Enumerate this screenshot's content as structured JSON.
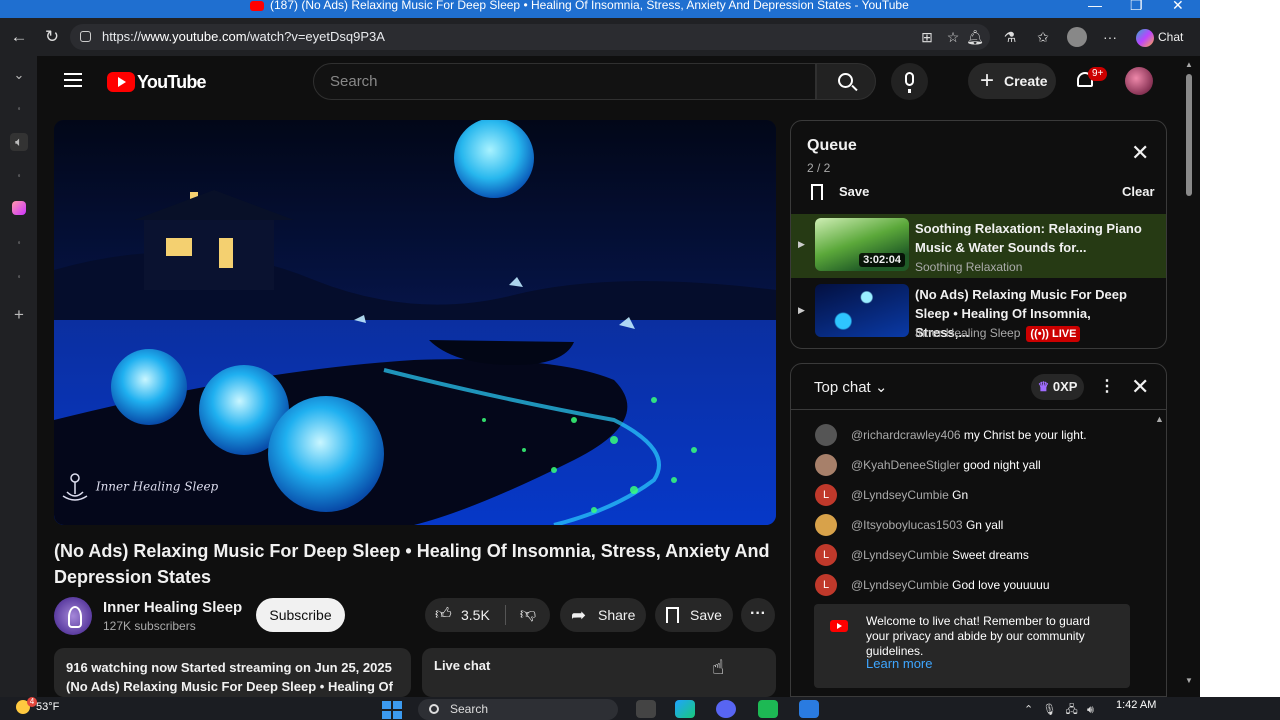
{
  "browser": {
    "tab_title": "(187) (No Ads) Relaxing Music For Deep Sleep • Healing Of Insomnia, Stress, Anxiety And Depression States - YouTube",
    "url_prefix": "https://",
    "url_host": "www.youtube.com",
    "url_path": "/watch?v=eyetDsq9P3A",
    "chat_label": "Chat"
  },
  "header": {
    "logo_text": "YouTube",
    "search_placeholder": "Search",
    "create_label": "Create",
    "notification_count": "9+"
  },
  "video": {
    "watermark": "Inner Healing Sleep",
    "title": "(No Ads) Relaxing Music For Deep Sleep • Healing Of Insomnia, Stress, Anxiety And Depression States",
    "channel_name": "Inner Healing Sleep",
    "subscribers": "127K subscribers",
    "subscribe_label": "Subscribe",
    "likes": "3.5K",
    "share_label": "Share",
    "save_label": "Save",
    "more_label": "···"
  },
  "description": {
    "line1": "916 watching now  Started streaming on Jun 25, 2025",
    "line2": "(No Ads) Relaxing Music For Deep Sleep • Healing Of"
  },
  "live_chat_box": {
    "label": "Live chat"
  },
  "queue": {
    "title": "Queue",
    "count": "2 / 2",
    "save_label": "Save",
    "clear_label": "Clear",
    "items": [
      {
        "title": "Soothing Relaxation: Relaxing Piano Music & Water Sounds for...",
        "channel": "Soothing Relaxation",
        "duration": "3:02:04",
        "active": true
      },
      {
        "title": "(No Ads) Relaxing Music For Deep Sleep • Healing Of Insomnia, Stress,...",
        "channel": "Inner Healing Sleep",
        "badge": "LIVE",
        "active": false
      }
    ]
  },
  "chat": {
    "header_label": "Top chat",
    "xp_label": "0XP",
    "messages": [
      {
        "author": "@richardcrawley406",
        "text": "my Christ be your light.",
        "avatar": "",
        "avatar_color": "#555555"
      },
      {
        "author": "@KyahDeneeStigler",
        "text": "good night yall",
        "avatar": "",
        "avatar_color": "#a7806a"
      },
      {
        "author": "@LyndseyCumbie",
        "text": "Gn",
        "avatar": "L",
        "avatar_color": "#c0392b"
      },
      {
        "author": "@Itsyoboylucas1503",
        "text": "Gn yall",
        "avatar": "",
        "avatar_color": "#d8a24a"
      },
      {
        "author": "@LyndseyCumbie",
        "text": "Sweet dreams",
        "avatar": "L",
        "avatar_color": "#c0392b"
      },
      {
        "author": "@LyndseyCumbie",
        "text": "God love youuuuu",
        "avatar": "L",
        "avatar_color": "#c0392b"
      }
    ],
    "welcome_text": "Welcome to live chat! Remember to guard your privacy and abide by our community guidelines.",
    "learn_more": "Learn more"
  },
  "taskbar": {
    "temperature": "53°F",
    "weather_alert": "4",
    "search_label": "Search",
    "time": "1:42 AM"
  },
  "colors": {
    "accent_red": "#ff0000",
    "link_blue": "#3ea6ff",
    "queue_active_bg": "#263a14"
  }
}
